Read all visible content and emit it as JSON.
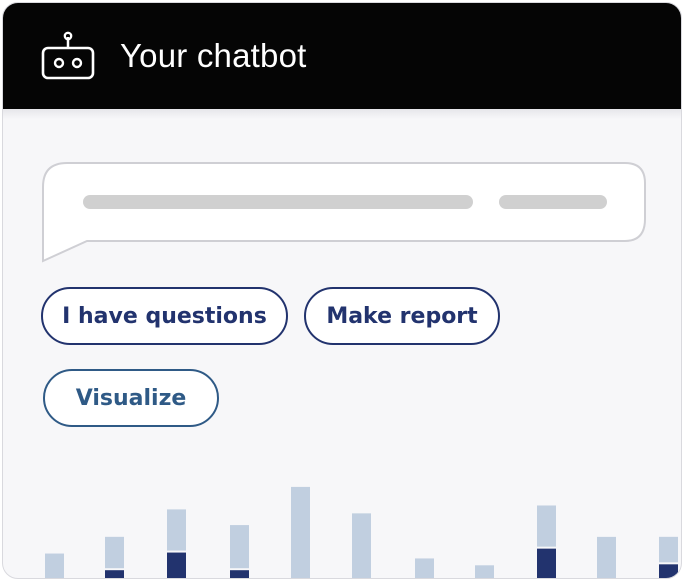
{
  "header": {
    "title": "Your chatbot",
    "icon": "robot-icon",
    "background": "#050505"
  },
  "message_bubble": {
    "state": "placeholder"
  },
  "suggestions": [
    {
      "label": "I have questions"
    },
    {
      "label": "Make report"
    },
    {
      "label": "Visualize"
    }
  ],
  "colors": {
    "accent": "#22336e",
    "bar_light": "#c1cfe0",
    "bar_dark": "#22336e"
  },
  "chart_data": {
    "type": "bar",
    "stacked": true,
    "series": [
      {
        "values": [
          0,
          10,
          28,
          10,
          0,
          0,
          0,
          0,
          32,
          0,
          16
        ]
      },
      {
        "values": [
          27,
          32,
          42,
          44,
          95,
          68,
          22,
          15,
          42,
          44,
          26
        ]
      }
    ],
    "ylim": [
      0,
      100
    ],
    "grid": false
  }
}
